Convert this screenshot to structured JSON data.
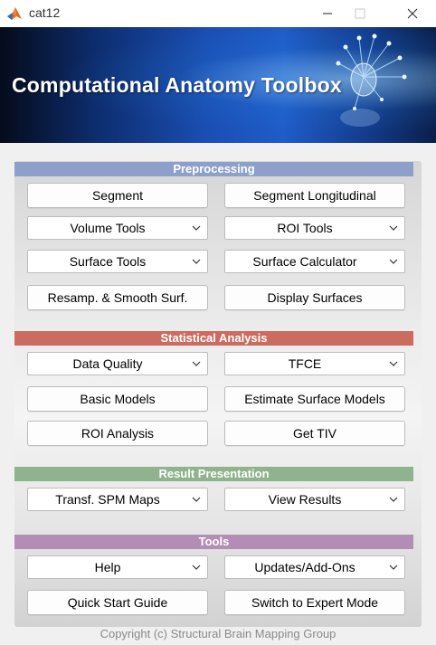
{
  "window": {
    "title": "cat12"
  },
  "banner": {
    "title": "Computational Anatomy Toolbox"
  },
  "sections": {
    "preprocessing": {
      "title": "Preprocessing",
      "segment": "Segment",
      "segment_longitudinal": "Segment Longitudinal",
      "volume_tools": "Volume Tools",
      "roi_tools": "ROI Tools",
      "surface_tools": "Surface Tools",
      "surface_calculator": "Surface Calculator",
      "resamp_smooth": "Resamp. & Smooth Surf.",
      "display_surfaces": "Display Surfaces"
    },
    "statistical": {
      "title": "Statistical Analysis",
      "data_quality": "Data Quality",
      "tfce": "TFCE",
      "basic_models": "Basic Models",
      "estimate_surface_models": "Estimate Surface Models",
      "roi_analysis": "ROI Analysis",
      "get_tiv": "Get TIV"
    },
    "result": {
      "title": "Result Presentation",
      "transf_spm_maps": "Transf. SPM Maps",
      "view_results": "View Results"
    },
    "tools": {
      "title": "Tools",
      "help": "Help",
      "updates": "Updates/Add-Ons",
      "quick_start": "Quick Start Guide",
      "expert_mode": "Switch to Expert Mode"
    }
  },
  "footer": {
    "copyright": "Copyright (c) Structural Brain Mapping Group"
  },
  "colors": {
    "preprocessing_bar": "#8da0c9",
    "statistical_bar": "#cc6b60",
    "result_bar": "#8fb38c",
    "tools_bar": "#b38db5"
  }
}
